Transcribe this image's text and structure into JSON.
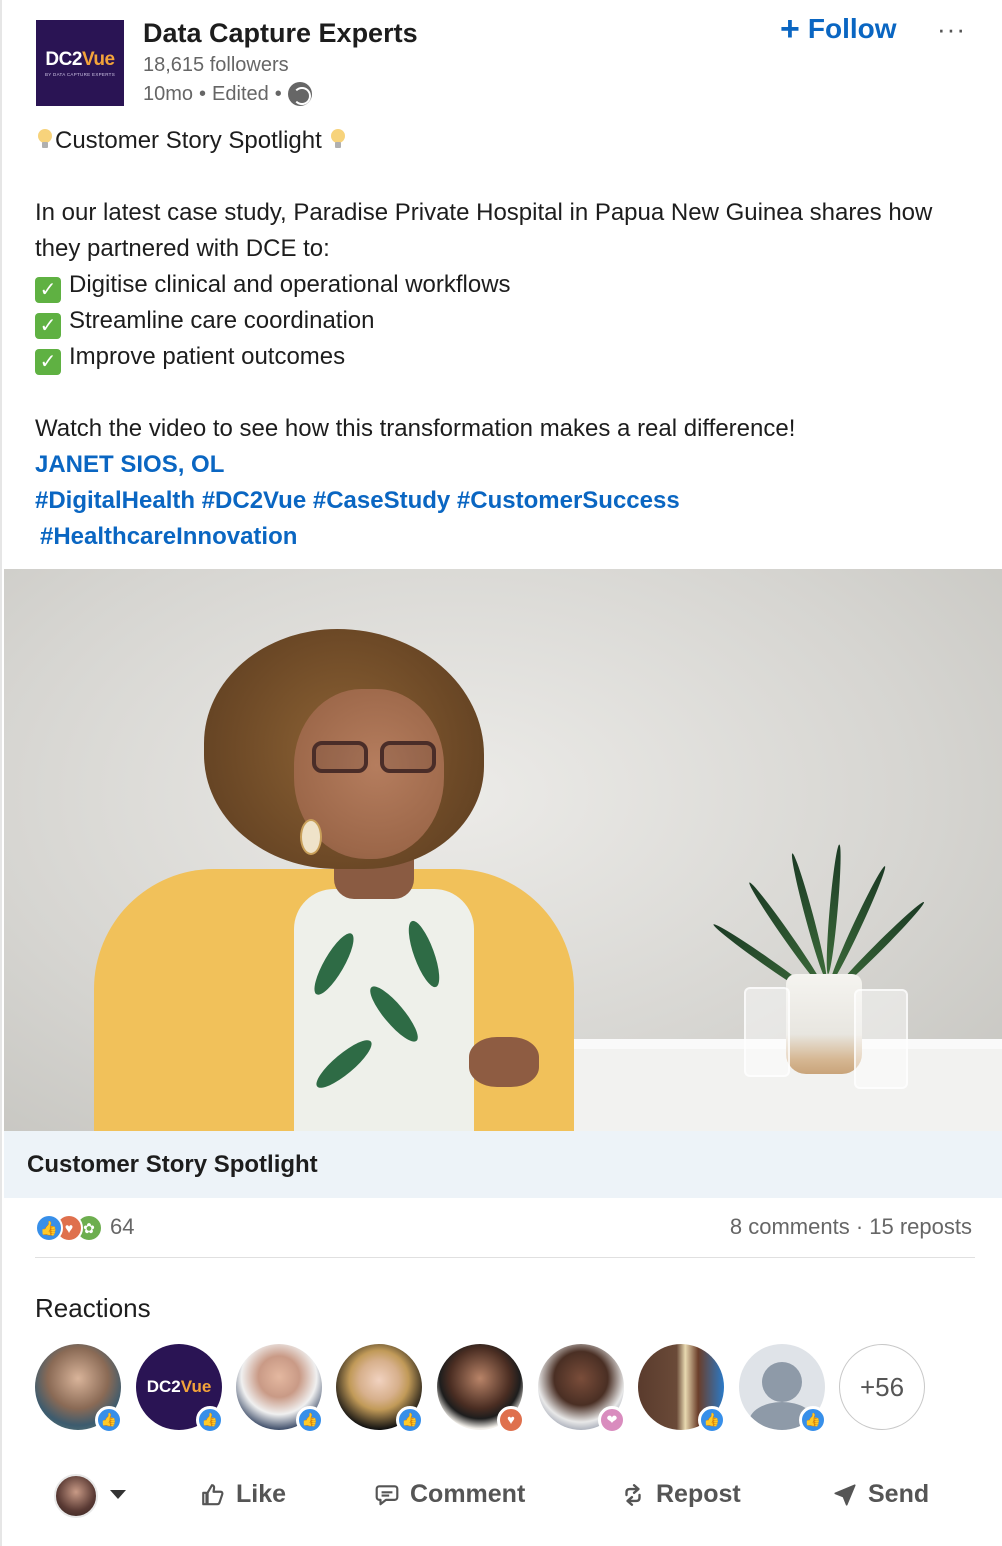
{
  "post": {
    "company_name": "Data Capture Experts",
    "followers": "18,615 followers",
    "time": "10mo",
    "edited": "Edited",
    "dot": "•",
    "follow_label": "Follow",
    "more_label": "···",
    "logo": {
      "main": "DC2",
      "accent": "Vue",
      "sub": "BY DATA CAPTURE EXPERTS"
    },
    "body": {
      "headline": "Customer Story Spotlight",
      "intro": "In our latest case study, Paradise Private Hospital in Papua New Guinea shares how they partnered with DCE to:",
      "bullets": [
        "Digitise clinical and operational workflows",
        "Streamline care coordination",
        "Improve patient outcomes"
      ],
      "cta": "Watch the video to see how this transformation makes a real difference!",
      "mention": "JANET SIOS, OL",
      "hashtags_line1": "#DigitalHealth #DC2Vue #CaseStudy #CustomerSuccess",
      "hashtags_line2": "#HealthcareInnovation"
    },
    "media_caption": "Customer Story Spotlight",
    "reaction_count": "64",
    "comments_reposts": "8 comments · 15 reposts",
    "reactions_title": "Reactions",
    "more_reactors": "+56",
    "reactor_badges": [
      "like",
      "like",
      "like",
      "like",
      "love",
      "care",
      "like",
      "like"
    ]
  },
  "actions": {
    "like": "Like",
    "comment": "Comment",
    "repost": "Repost",
    "send": "Send"
  },
  "colors": {
    "link": "#0a66c2",
    "caption_bg": "#edf3f8",
    "logo_bg": "#2a1454",
    "logo_accent": "#f3a33a"
  }
}
